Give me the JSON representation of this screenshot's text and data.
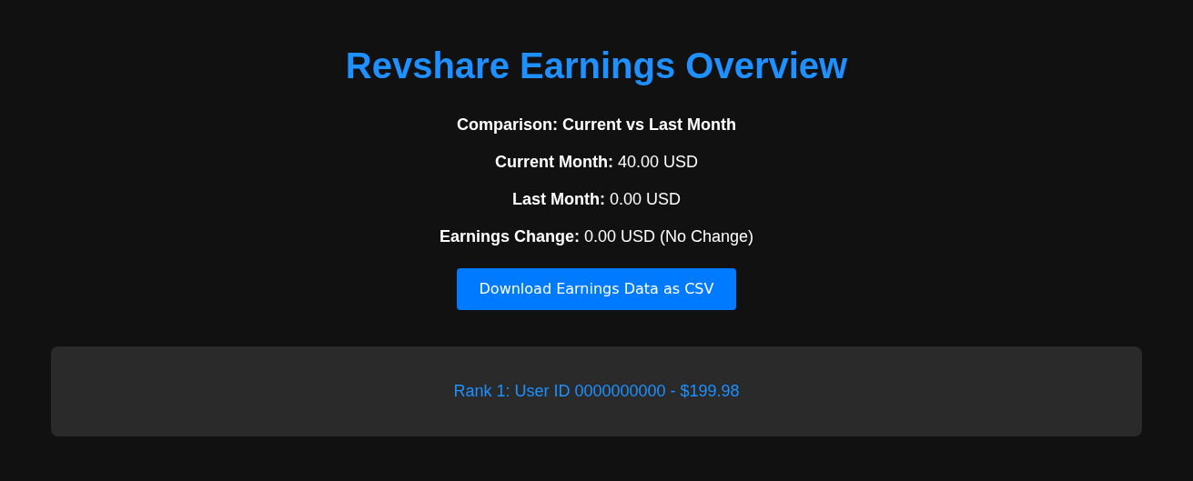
{
  "title": "Revshare Earnings Overview",
  "comparison_heading": "Comparison: Current vs Last Month",
  "stats": [
    "**Current Month:** 40.00 USD",
    "**Last Month:** 0.00 USD",
    "**Earnings Change:** 0.00 USD (No Change)"
  ],
  "download_button": "Download Earnings Data as CSV",
  "leaderboard": [
    "Rank 1: User ID 0000000000 - $199.98"
  ]
}
